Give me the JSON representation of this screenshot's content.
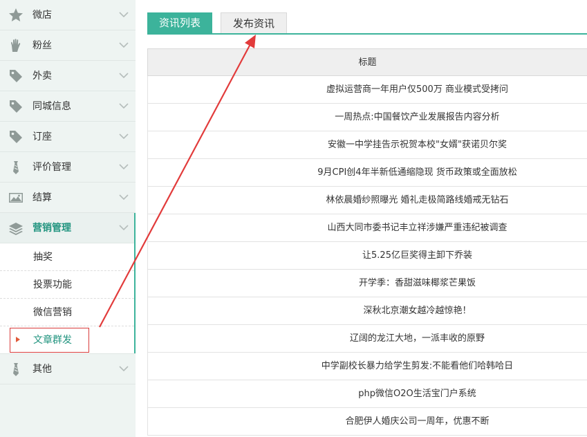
{
  "sidebar": {
    "items": [
      {
        "label": "微店",
        "icon": "star-icon"
      },
      {
        "label": "粉丝",
        "icon": "hand-icon"
      },
      {
        "label": "外卖",
        "icon": "tag-icon"
      },
      {
        "label": "同城信息",
        "icon": "tag-icon"
      },
      {
        "label": "订座",
        "icon": "tag-icon"
      },
      {
        "label": "评价管理",
        "icon": "tie-icon"
      },
      {
        "label": "结算",
        "icon": "image-icon"
      },
      {
        "label": "营销管理",
        "icon": "layers-icon",
        "active": true
      },
      {
        "label": "其他",
        "icon": "tie-icon"
      }
    ],
    "submenu": [
      "抽奖",
      "投票功能",
      "微信营销",
      "文章群发"
    ],
    "active_submenu": "文章群发"
  },
  "tabs": {
    "list_label": "资讯列表",
    "publish_label": "发布资讯"
  },
  "table": {
    "header": "标题",
    "rows": [
      "虚拟运营商一年用户仅500万 商业模式受拷问",
      "一周热点:中国餐饮产业发展报告内容分析",
      "安徽一中学挂告示祝贺本校\"女婿\"获诺贝尔奖",
      "9月CPI创4年半新低通缩隐现 货币政策或全面放松",
      "林依晨婚纱照曝光 婚礼走极简路线婚戒无钻石",
      "山西大同市委书记丰立祥涉嫌严重违纪被调查",
      "让5.25亿巨奖得主卸下乔装",
      "开学季：香甜滋味椰浆芒果饭",
      "深秋北京潮女越冷越惊艳！",
      "辽阔的龙江大地，一派丰收的原野",
      "中学副校长暴力给学生剪发:不能看他们哈韩哈日",
      "php微信O2O生活宝门户系统",
      "合肥伊人婚庆公司一周年，优惠不断"
    ]
  },
  "colors": {
    "accent": "#3cb39b",
    "annotation": "#e23b3b"
  }
}
